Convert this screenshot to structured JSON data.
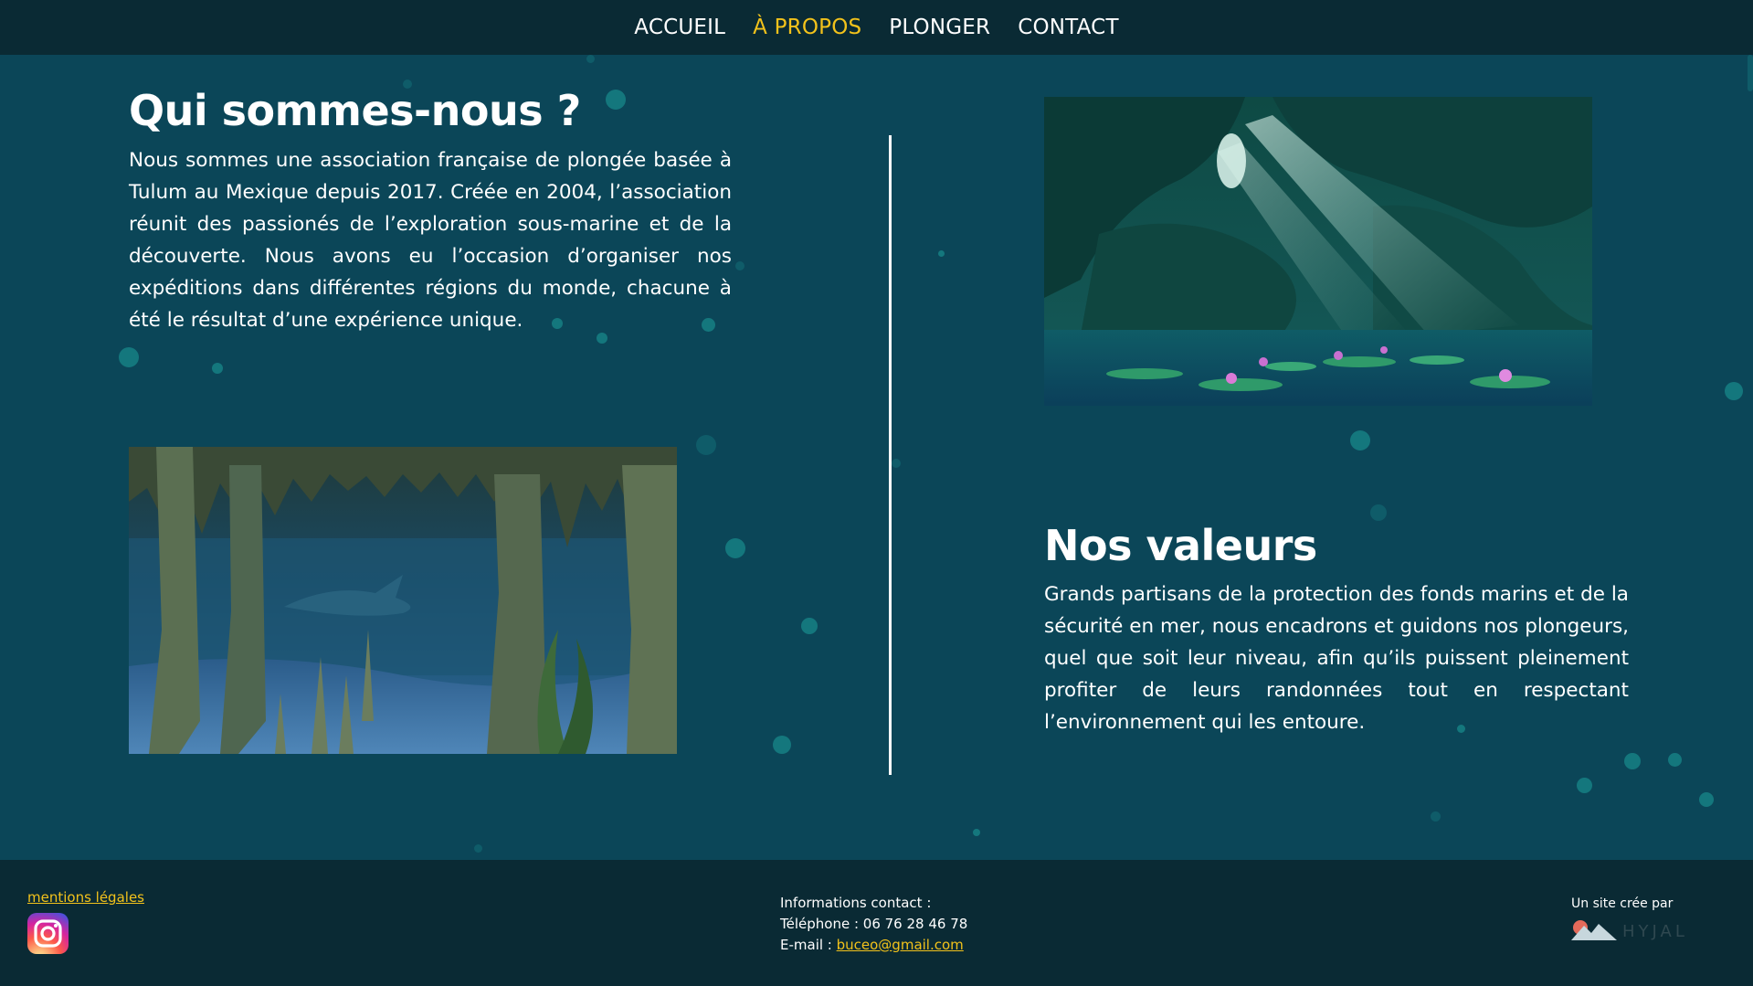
{
  "nav": {
    "items": [
      {
        "label": "ACCUEIL",
        "active": false
      },
      {
        "label": "À PROPOS",
        "active": true
      },
      {
        "label": "PLONGER",
        "active": false
      },
      {
        "label": "CONTACT",
        "active": false
      }
    ],
    "active_color": "#f2c21b"
  },
  "about": {
    "title": "Qui sommes-nous ?",
    "text": "Nous sommes une association française de plongée basée à Tulum au Mexique depuis 2017. Créée en 2004, l’association réunit des passionés de l’exploration sous-marine et de la découverte. Nous avons eu l’occasion d’organiser nos expéditions dans différentes régions du monde, chacune à été le résultat d’une expérience unique."
  },
  "values": {
    "title": "Nos valeurs",
    "text": "Grands partisans de la protection des fonds marins et de la sécurité en mer, nous encadrons et guidons nos plongeurs, quel que soit leur niveau, afin qu’ils puissent pleinement profiter de leurs randonnées tout en respectant l’environnement qui les entoure."
  },
  "images": {
    "cave_light": "underwater cave with light rays and water lilies",
    "cave_stalactites": "underwater cave with stalactites and a shark"
  },
  "footer": {
    "legal": "mentions légales",
    "instagram_icon": "instagram-icon",
    "contact_title": "Informations contact :",
    "phone": "Téléphone : 06 76 28 46 78",
    "email_label": "E-mail : ",
    "email": "buceo@gmail.com",
    "credit": "Un site crée par",
    "logo_text": "HYJAL"
  },
  "colors": {
    "background": "#0b4658",
    "nav_footer": "#0a2a34",
    "accent": "#f2c21b",
    "bubble": "#18888a"
  }
}
